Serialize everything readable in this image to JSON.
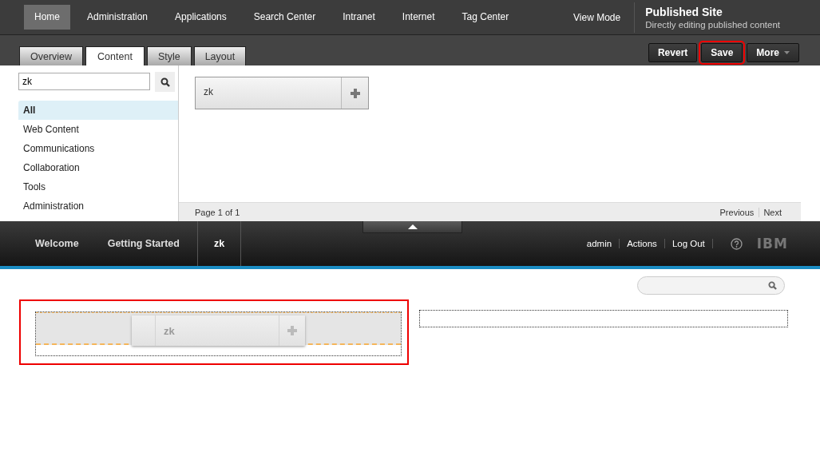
{
  "top_nav": {
    "items": [
      {
        "label": "Home",
        "selected": true
      },
      {
        "label": "Administration",
        "selected": false
      },
      {
        "label": "Applications",
        "selected": false
      },
      {
        "label": "Search Center",
        "selected": false
      },
      {
        "label": "Intranet",
        "selected": false
      },
      {
        "label": "Internet",
        "selected": false
      },
      {
        "label": "Tag Center",
        "selected": false
      }
    ],
    "view_mode": "View Mode",
    "site_title": "Published Site",
    "site_subtitle": "Directly editing published content"
  },
  "tabs": [
    {
      "label": "Overview",
      "selected": false
    },
    {
      "label": "Content",
      "selected": true
    },
    {
      "label": "Style",
      "selected": false
    },
    {
      "label": "Layout",
      "selected": false
    }
  ],
  "actions": [
    {
      "label": "Revert",
      "highlighted": false,
      "dropdown": false
    },
    {
      "label": "Save",
      "highlighted": true,
      "dropdown": false
    },
    {
      "label": "More",
      "highlighted": false,
      "dropdown": true
    }
  ],
  "content_panel": {
    "search": {
      "value": "zk"
    },
    "categories": [
      {
        "label": "All",
        "selected": true
      },
      {
        "label": "Web Content",
        "selected": false
      },
      {
        "label": "Communications",
        "selected": false
      },
      {
        "label": "Collaboration",
        "selected": false
      },
      {
        "label": "Tools",
        "selected": false
      },
      {
        "label": "Administration",
        "selected": false
      }
    ],
    "results": [
      {
        "label": "zk"
      }
    ],
    "page_info": "Page 1 of 1",
    "previous": "Previous",
    "next": "Next"
  },
  "portal_bar": {
    "pages": [
      {
        "label": "Welcome",
        "selected": false
      },
      {
        "label": "Getting Started",
        "selected": false
      },
      {
        "label": "zk",
        "selected": true
      }
    ],
    "user": "admin",
    "actions": "Actions",
    "logout": "Log Out",
    "logo": "IBM"
  },
  "page": {
    "drop_zone": {
      "highlighted": true,
      "dragged_item": "zk"
    }
  }
}
